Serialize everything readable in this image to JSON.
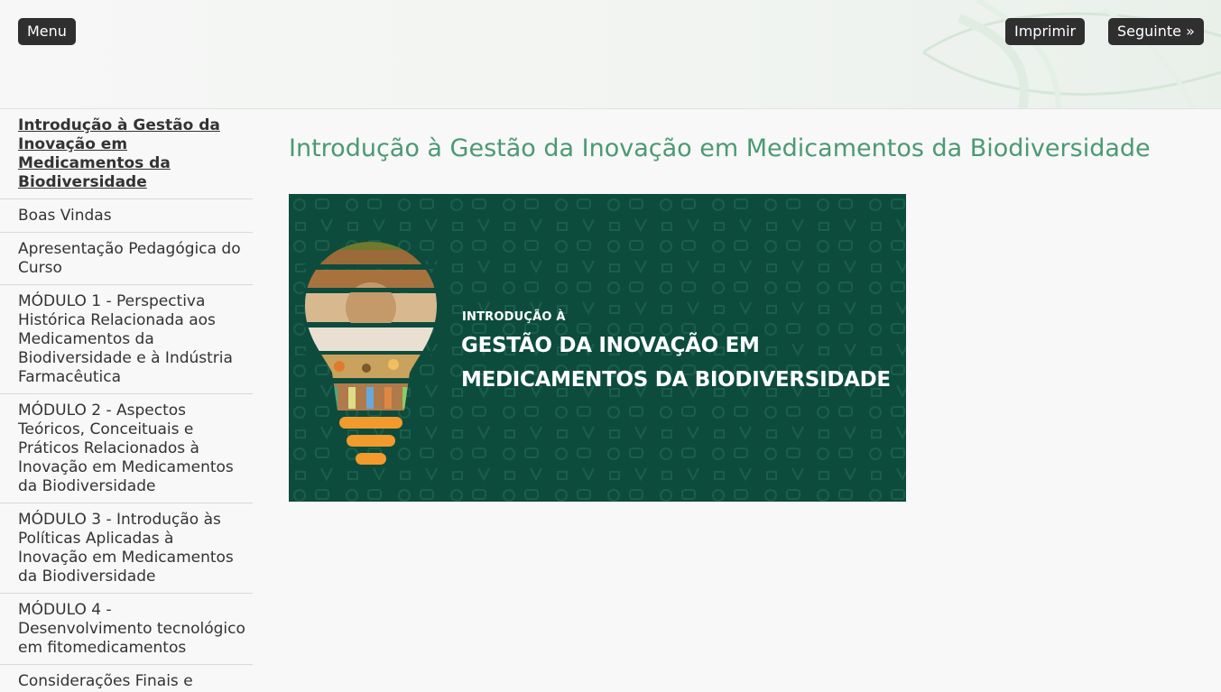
{
  "header": {
    "menu_label": "Menu",
    "print_label": "Imprimir",
    "next_label": "Seguinte »"
  },
  "sidebar": {
    "items": [
      {
        "label": "Introdução à Gestão da Inovação em Medicamentos da Biodiversidade",
        "current": true
      },
      {
        "label": "Boas Vindas"
      },
      {
        "label": "Apresentação Pedagógica do Curso"
      },
      {
        "label": "MÓDULO 1 - Perspectiva Histórica Relacionada aos Medicamentos da Biodiversidade e à Indústria Farmacêutica"
      },
      {
        "label": "MÓDULO 2 - Aspectos Teóricos, Conceituais e Práticos Relacionados à Inovação em Medicamentos da Biodiversidade"
      },
      {
        "label": "MÓDULO 3 - Introdução às Políticas Aplicadas à Inovação em Medicamentos da Biodiversidade"
      },
      {
        "label": "MÓDULO 4 - Desenvolvimento tecnológico em fitomedicamentos"
      },
      {
        "label": "Considerações Finais e"
      }
    ]
  },
  "main": {
    "title": "Introdução à Gestão da Inovação em Medicamentos da Biodiversidade",
    "banner": {
      "subtitle": "INTRODUÇÃO À",
      "line1": "GESTÃO DA INOVAÇÃO EM",
      "line2": "MEDICAMENTOS DA BIODIVERSIDADE",
      "icon": "lightbulb-icon"
    }
  },
  "colors": {
    "title_green": "#4a9a73",
    "banner_green": "#0d4c3d",
    "bulb_orange": "#f39a2c",
    "button_dark": "#2f2f2f"
  }
}
